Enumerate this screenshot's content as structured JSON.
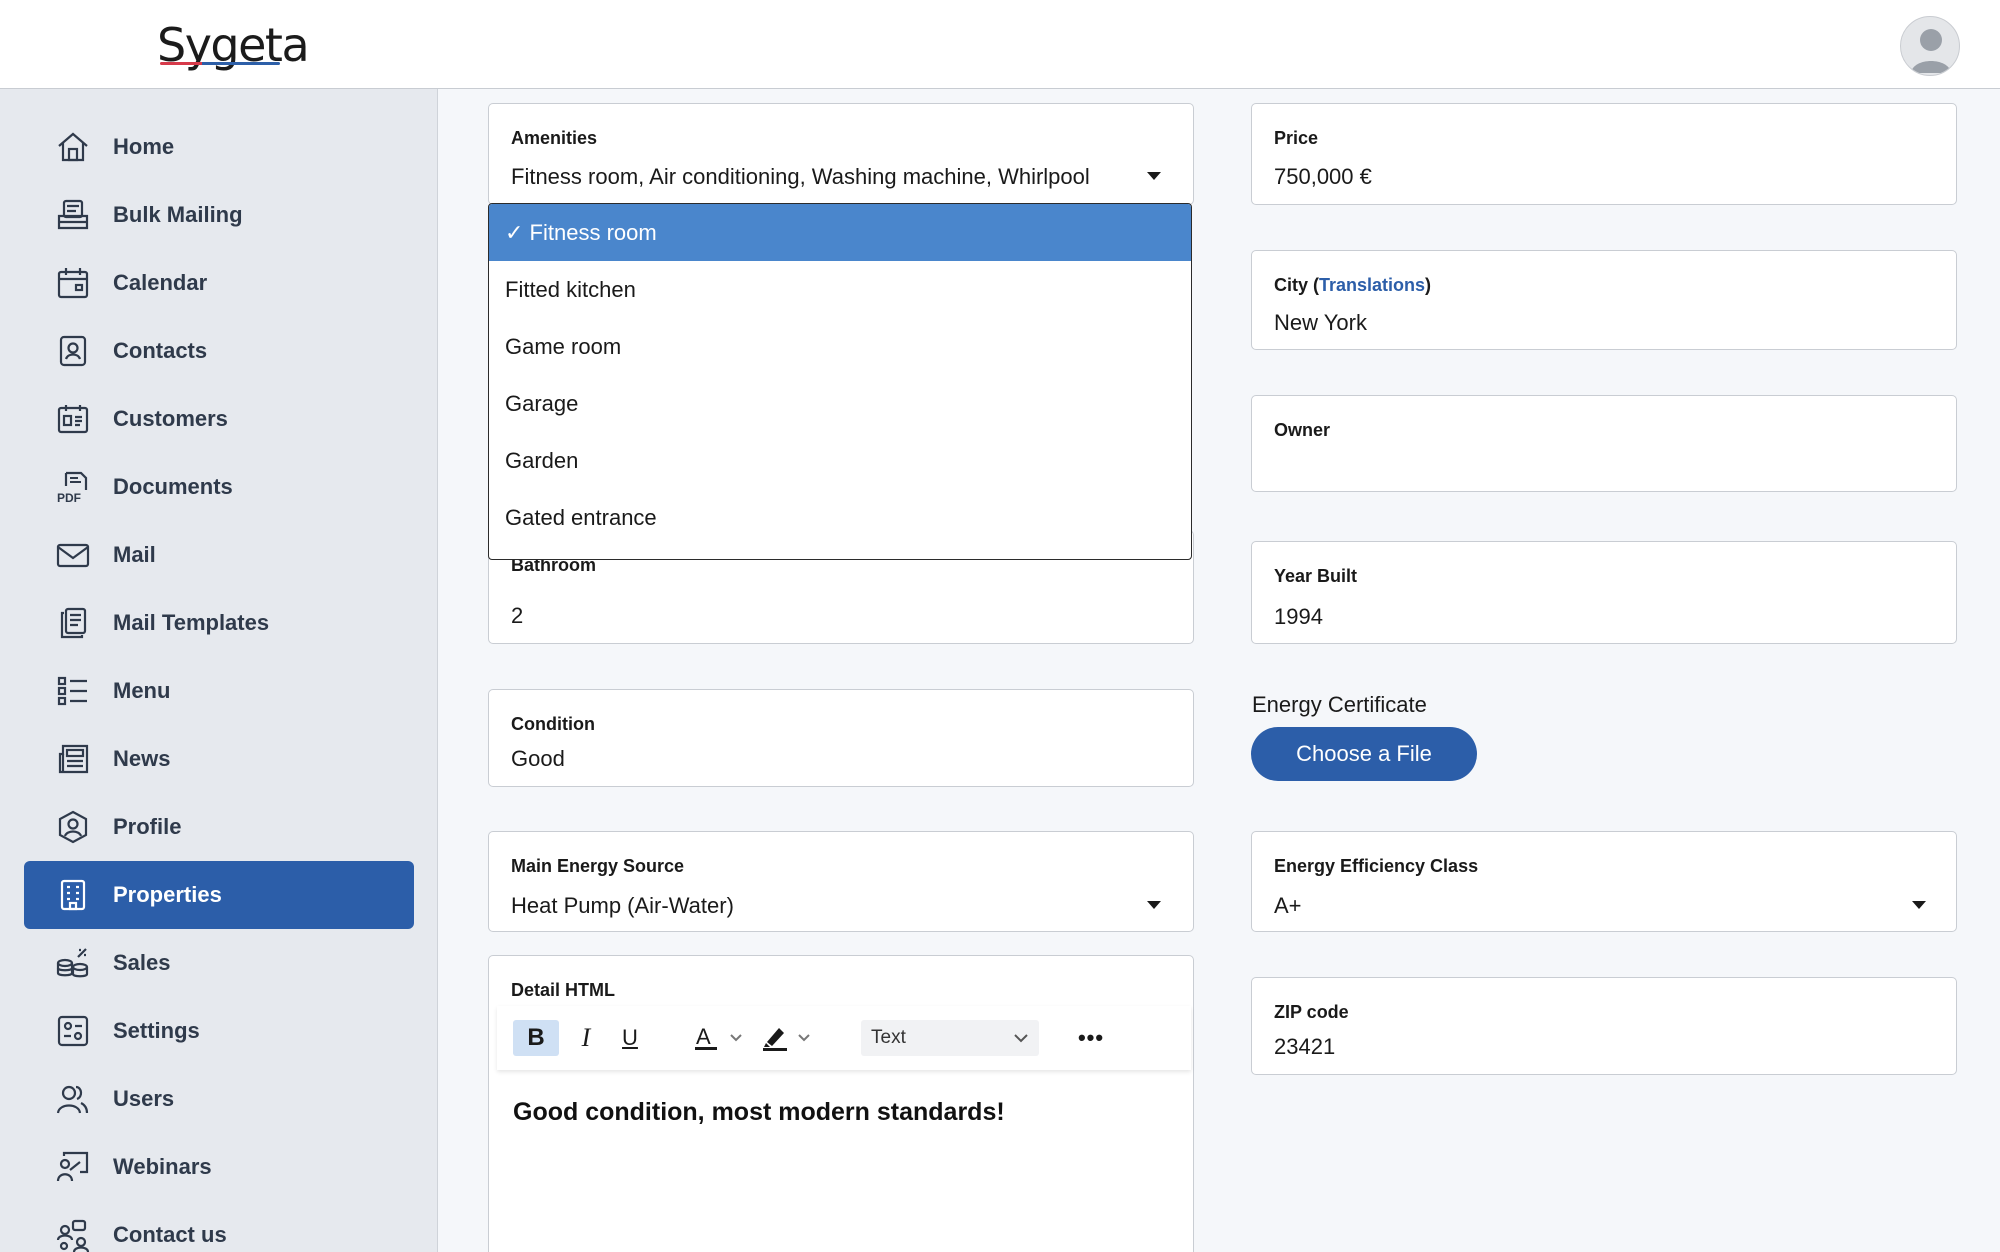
{
  "app": {
    "logo_text": "Sygeta"
  },
  "sidebar": {
    "items": [
      {
        "label": "Home",
        "icon": "home-icon"
      },
      {
        "label": "Bulk Mailing",
        "icon": "bulk-mailing-icon"
      },
      {
        "label": "Calendar",
        "icon": "calendar-icon"
      },
      {
        "label": "Contacts",
        "icon": "contacts-icon"
      },
      {
        "label": "Customers",
        "icon": "customers-icon"
      },
      {
        "label": "Documents",
        "icon": "pdf-document-icon"
      },
      {
        "label": "Mail",
        "icon": "mail-icon"
      },
      {
        "label": "Mail Templates",
        "icon": "mail-templates-icon"
      },
      {
        "label": "Menu",
        "icon": "menu-list-icon"
      },
      {
        "label": "News",
        "icon": "news-icon"
      },
      {
        "label": "Profile",
        "icon": "profile-icon"
      },
      {
        "label": "Properties",
        "icon": "building-icon",
        "active": true
      },
      {
        "label": "Sales",
        "icon": "sales-coins-icon"
      },
      {
        "label": "Settings",
        "icon": "settings-icon"
      },
      {
        "label": "Users",
        "icon": "users-icon"
      },
      {
        "label": "Webinars",
        "icon": "webinars-icon"
      },
      {
        "label": "Contact us",
        "icon": "contact-us-icon"
      }
    ]
  },
  "form": {
    "amenities": {
      "label": "Amenities",
      "value": "Fitness room, Air conditioning, Washing machine, Whirlpool",
      "options": [
        {
          "label": "✓ Fitness room",
          "selected": true
        },
        {
          "label": "Fitted kitchen"
        },
        {
          "label": "Game room"
        },
        {
          "label": "Garage"
        },
        {
          "label": "Garden"
        },
        {
          "label": "Gated entrance"
        }
      ]
    },
    "bathroom": {
      "label": "Bathroom",
      "value": "2"
    },
    "condition": {
      "label": "Condition",
      "value": "Good"
    },
    "main_energy_source": {
      "label": "Main Energy Source",
      "value": "Heat Pump (Air-Water)"
    },
    "detail_html": {
      "label": "Detail HTML",
      "toolbar": {
        "bold": "B",
        "italic": "I",
        "underline": "U",
        "block_format": "Text",
        "more": "•••"
      },
      "content": "Good condition, most modern standards!"
    },
    "price": {
      "label": "Price",
      "value": "750,000 €"
    },
    "city": {
      "label": "City",
      "paren_open": " (",
      "link": "Translations",
      "paren_close": ")",
      "value": "New York"
    },
    "owner": {
      "label": "Owner",
      "value": ""
    },
    "year_built": {
      "label": "Year Built",
      "value": "1994"
    },
    "energy_certificate": {
      "label": "Energy Certificate",
      "button": "Choose a File"
    },
    "energy_efficiency_class": {
      "label": "Energy Efficiency Class",
      "value": "A+"
    },
    "zip_code": {
      "label": "ZIP code",
      "value": "23421"
    }
  },
  "colors": {
    "accent": "#2c5ea9",
    "option_highlight": "#4a86cc",
    "sidebar_bg": "#e6e9ee"
  }
}
